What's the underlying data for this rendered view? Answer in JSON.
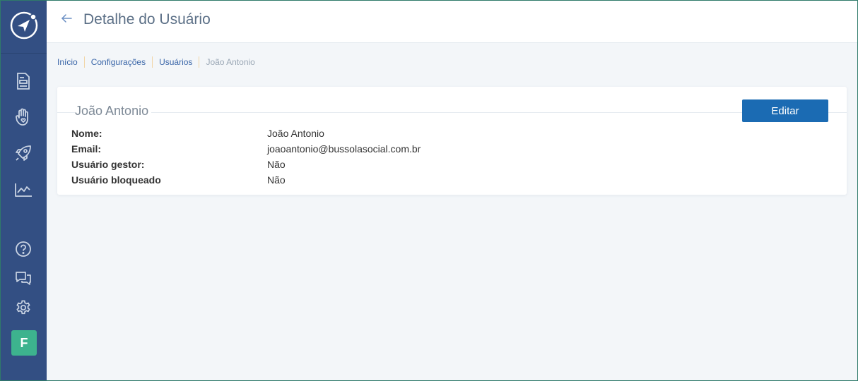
{
  "sidebar": {
    "logo_icon": "compass-logo-icon",
    "nav_icons": [
      "document-icon",
      "hand-heart-icon",
      "rocket-icon",
      "chart-line-icon"
    ],
    "bottom_icons": [
      "help-icon",
      "chat-icon",
      "gear-icon"
    ],
    "avatar_letter": "F",
    "colors": {
      "background": "#334f83",
      "avatar": "#3db38e"
    }
  },
  "header": {
    "title": "Detalhe do Usuário",
    "back_icon": "arrow-left-icon"
  },
  "breadcrumb": {
    "items": [
      "Início",
      "Configurações",
      "Usuários",
      "João Antonio"
    ]
  },
  "card": {
    "title": "João Antonio",
    "edit_label": "Editar",
    "fields": [
      {
        "label": "Nome:",
        "value": "João Antonio"
      },
      {
        "label": "Email:",
        "value": "joaoantonio@bussolasocial.com.br"
      },
      {
        "label": "Usuário gestor:",
        "value": "Não"
      },
      {
        "label": "Usuário bloqueado",
        "value": "Não"
      }
    ]
  },
  "colors": {
    "accent": "#1b6bb3",
    "link": "#3a66a8"
  }
}
